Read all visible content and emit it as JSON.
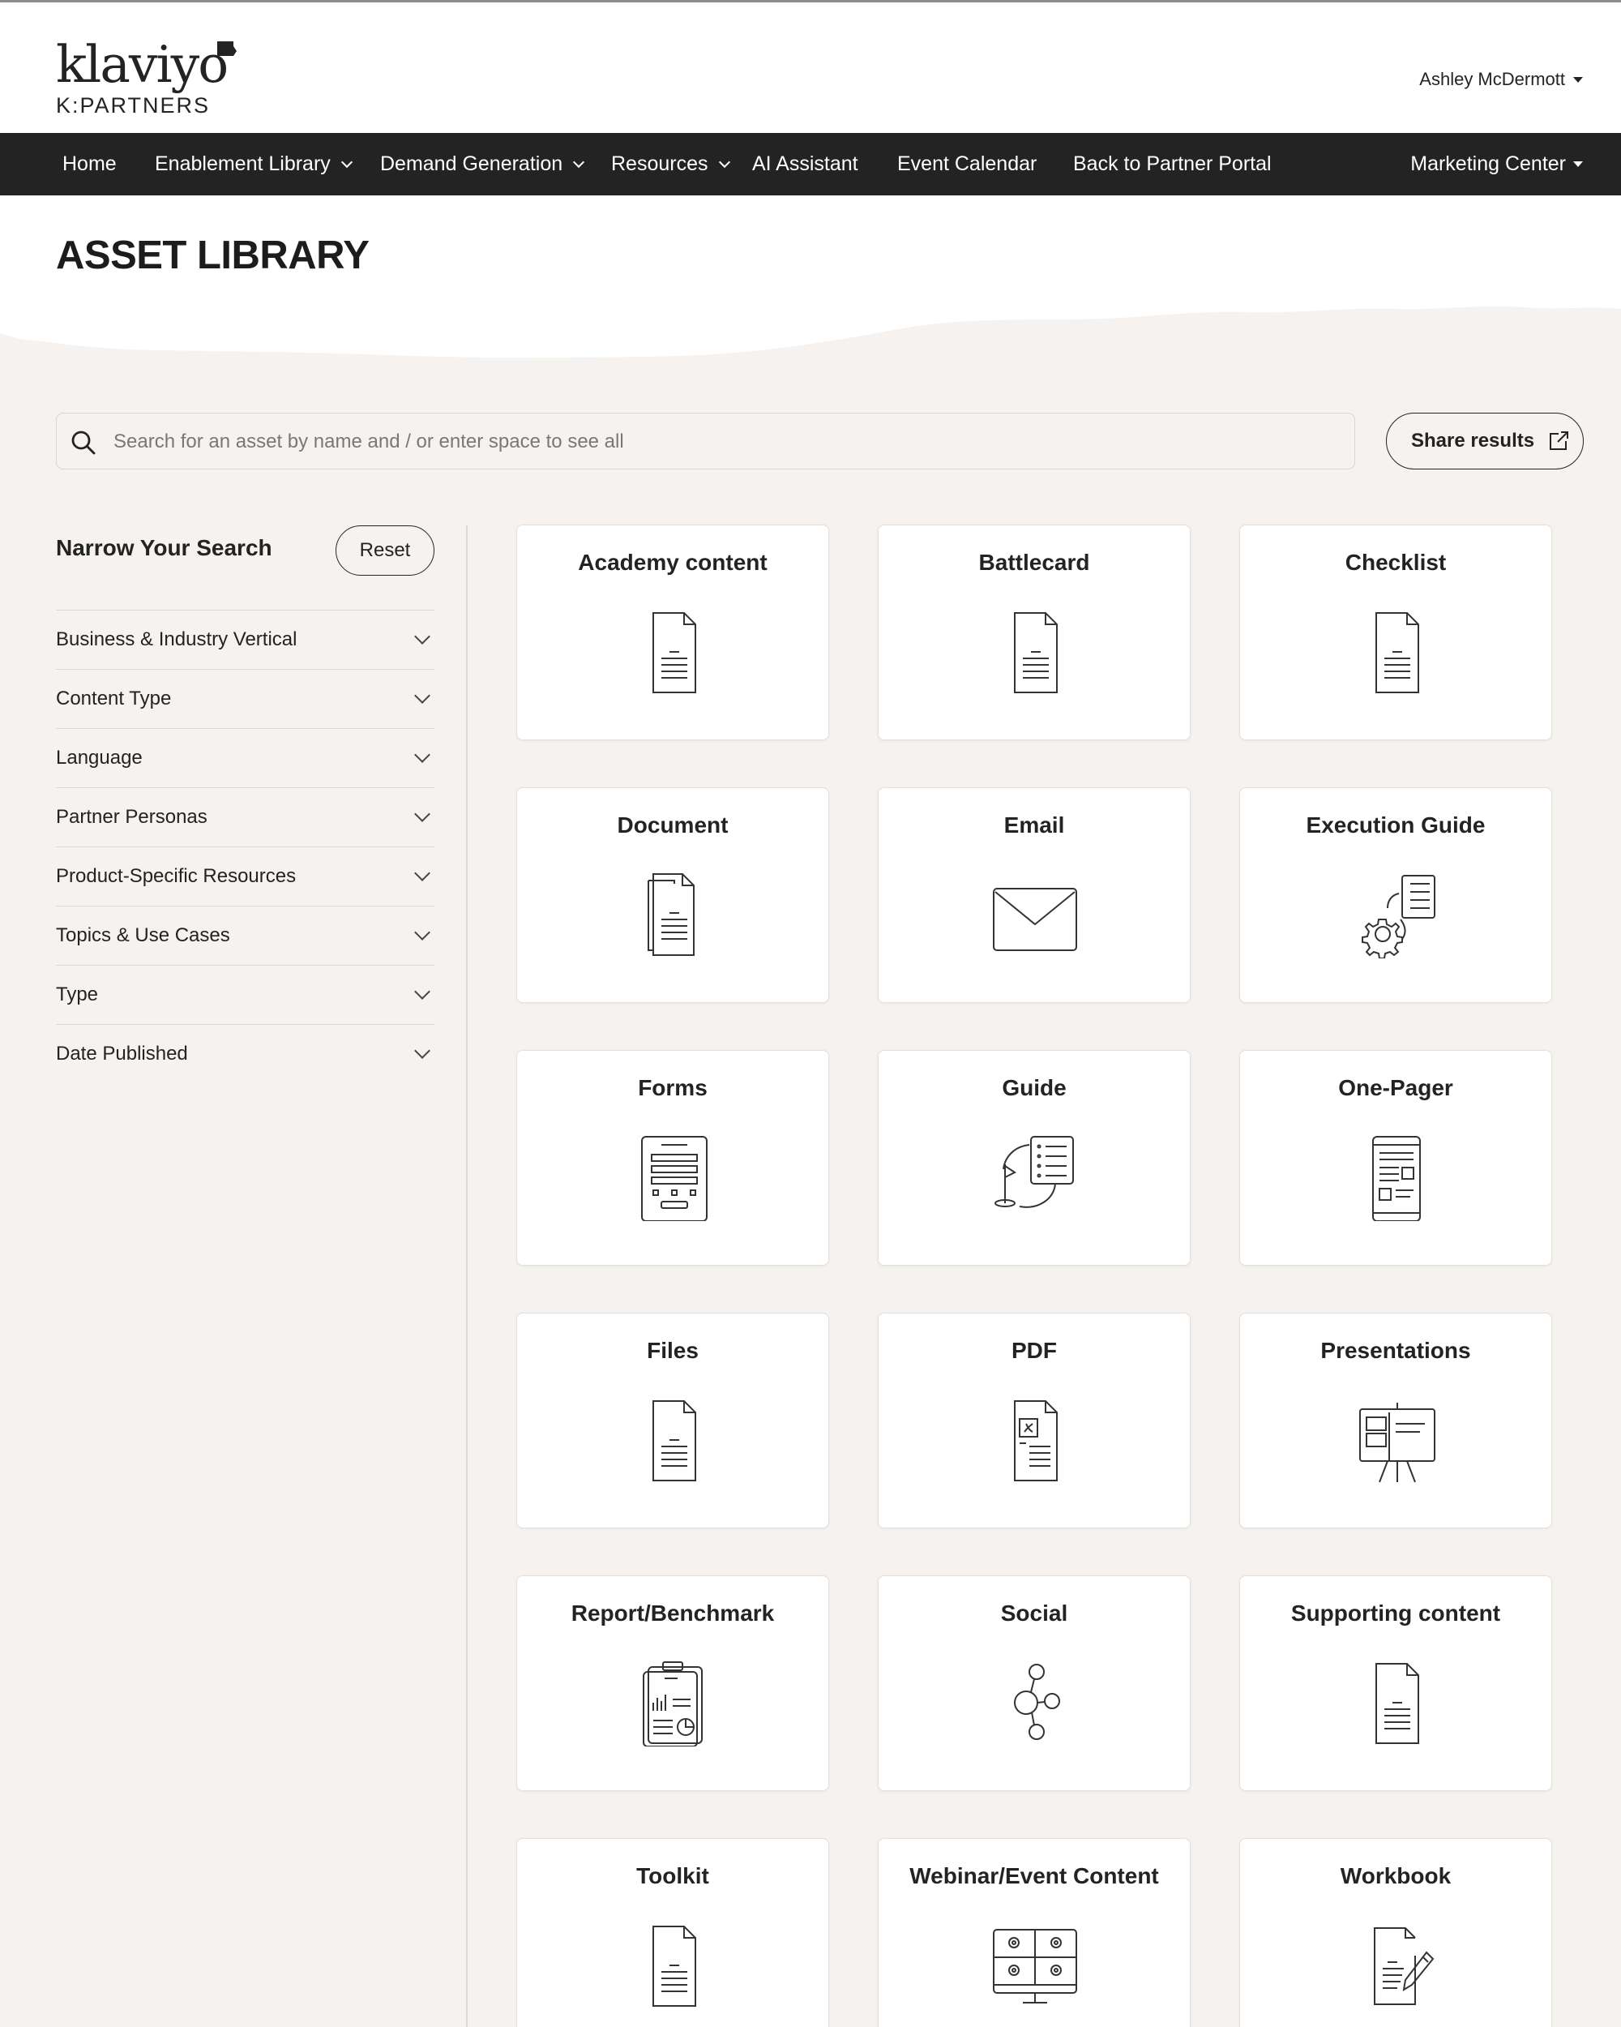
{
  "header": {
    "logo_word": "klaviyo",
    "logo_sub": "K:PARTNERS",
    "user_name": "Ashley McDermott"
  },
  "nav": {
    "items": [
      {
        "label": "Home"
      },
      {
        "label": "Enablement Library"
      },
      {
        "label": "Demand Generation"
      },
      {
        "label": "Resources"
      },
      {
        "label": "AI Assistant"
      },
      {
        "label": "Event Calendar"
      },
      {
        "label": "Back to Partner Portal"
      }
    ],
    "right_item": "Marketing Center"
  },
  "page": {
    "title": "ASSET LIBRARY"
  },
  "search": {
    "placeholder": "Search for an asset by name and / or enter space to see all",
    "share_label": "Share results"
  },
  "sidebar": {
    "title": "Narrow Your Search",
    "reset_label": "Reset",
    "filters": [
      {
        "label": "Business & Industry Vertical"
      },
      {
        "label": "Content Type"
      },
      {
        "label": "Language"
      },
      {
        "label": "Partner Personas"
      },
      {
        "label": "Product-Specific Resources"
      },
      {
        "label": "Topics & Use Cases"
      },
      {
        "label": "Type"
      },
      {
        "label": "Date Published"
      }
    ]
  },
  "cards": [
    {
      "title": "Academy content",
      "icon": "document-icon"
    },
    {
      "title": "Battlecard",
      "icon": "document-icon"
    },
    {
      "title": "Checklist",
      "icon": "document-icon"
    },
    {
      "title": "Document",
      "icon": "documents-stack-icon"
    },
    {
      "title": "Email",
      "icon": "envelope-icon"
    },
    {
      "title": "Execution Guide",
      "icon": "gear-checklist-icon"
    },
    {
      "title": "Forms",
      "icon": "form-icon"
    },
    {
      "title": "Guide",
      "icon": "guide-flag-icon"
    },
    {
      "title": "One-Pager",
      "icon": "one-pager-icon"
    },
    {
      "title": "Files",
      "icon": "document-icon"
    },
    {
      "title": "PDF",
      "icon": "pdf-icon"
    },
    {
      "title": "Presentations",
      "icon": "presentation-easel-icon"
    },
    {
      "title": "Report/Benchmark",
      "icon": "report-clipboard-icon"
    },
    {
      "title": "Social",
      "icon": "social-share-icon"
    },
    {
      "title": "Supporting content",
      "icon": "document-icon"
    },
    {
      "title": "Toolkit",
      "icon": "document-icon"
    },
    {
      "title": "Webinar/Event Content",
      "icon": "webinar-monitor-icon"
    },
    {
      "title": "Workbook",
      "icon": "workbook-pencil-icon"
    }
  ]
}
